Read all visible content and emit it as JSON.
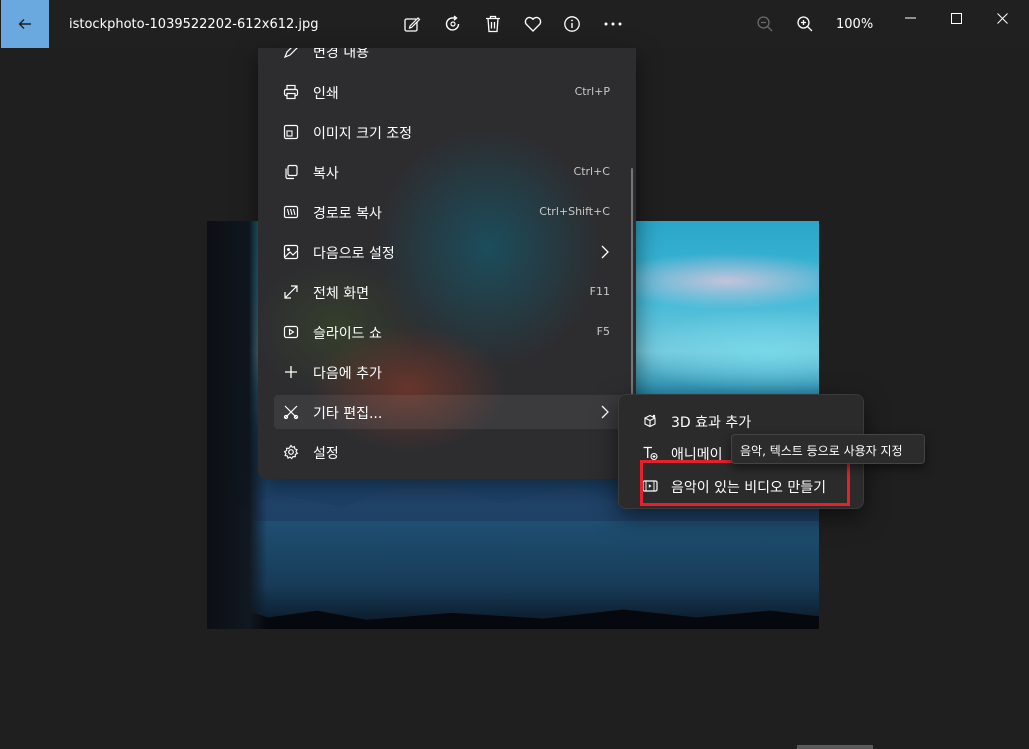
{
  "app": {
    "file_name": "istockphoto-1039522202-612x612.jpg",
    "zoom": "100%"
  },
  "toolbar": {
    "icons": [
      "edit-icon",
      "rotate-icon",
      "delete-icon",
      "heart-icon",
      "info-icon",
      "more-icon"
    ],
    "zoom_out_icon": "zoom-out-icon",
    "zoom_in_icon": "zoom-in-icon"
  },
  "menu": {
    "items": [
      {
        "label": "변경 내용",
        "shortcut": "",
        "icon": "edit-changes-icon"
      },
      {
        "label": "인쇄",
        "shortcut": "Ctrl+P",
        "icon": "print-icon"
      },
      {
        "label": "이미지 크기 조정",
        "shortcut": "",
        "icon": "resize-icon"
      },
      {
        "label": "복사",
        "shortcut": "Ctrl+C",
        "icon": "copy-icon"
      },
      {
        "label": "경로로 복사",
        "shortcut": "Ctrl+Shift+C",
        "icon": "copy-path-icon"
      },
      {
        "label": "다음으로 설정",
        "shortcut": "",
        "icon": "set-as-icon",
        "has_submenu": true
      },
      {
        "label": "전체 화면",
        "shortcut": "F11",
        "icon": "fullscreen-icon"
      },
      {
        "label": "슬라이드 쇼",
        "shortcut": "F5",
        "icon": "slideshow-icon"
      },
      {
        "label": "다음에 추가",
        "shortcut": "",
        "icon": "add-icon"
      },
      {
        "label": "기타 편집...",
        "shortcut": "",
        "icon": "more-edits-icon",
        "has_submenu": true,
        "active": true
      },
      {
        "label": "설정",
        "shortcut": "",
        "icon": "settings-icon"
      }
    ]
  },
  "submenu": {
    "items": [
      {
        "label": "3D 효과 추가",
        "icon": "effects-3d-icon"
      },
      {
        "label": "애니메이",
        "icon": "animated-text-icon"
      },
      {
        "label": "음악이 있는 비디오 만들기",
        "icon": "video-music-icon"
      }
    ]
  },
  "tooltip": {
    "text": "음악, 텍스트 등으로 사용자 지정"
  },
  "colors": {
    "accent": "#6aa9e0",
    "highlight": "#e81f2c"
  }
}
